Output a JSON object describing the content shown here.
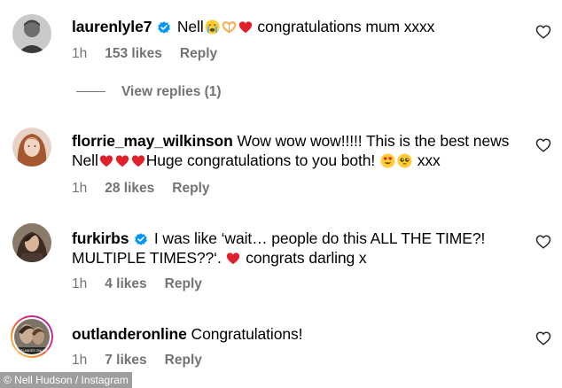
{
  "comments": [
    {
      "username": "laurenlyle7",
      "verified": true,
      "text_before": "Nell",
      "emojis": [
        "sobbing-face",
        "heart-hands",
        "red-heart"
      ],
      "text_after": "congratulations mum xxxx",
      "time": "1h",
      "likes": "153 likes",
      "reply": "Reply",
      "view_replies": "View replies (1)"
    },
    {
      "username": "florrie_may_wilkinson",
      "verified": false,
      "text_part1": "Wow wow wow!!!!! This is the best news Nell",
      "emojis1": [
        "red-heart",
        "red-heart",
        "red-heart"
      ],
      "text_part2": "Huge congratulations to you both!",
      "emojis2": [
        "heart-eyes-face",
        "pleading-face"
      ],
      "text_part3": "xxx",
      "time": "1h",
      "likes": "28 likes",
      "reply": "Reply"
    },
    {
      "username": "furkirbs",
      "verified": true,
      "text_part1": "I was like ‘wait… people do this ALL THE TIME?! MULTIPLE TIMES??‘.",
      "emojis1": [
        "red-heart"
      ],
      "text_part2": "congrats darling x",
      "time": "1h",
      "likes": "4 likes",
      "reply": "Reply"
    },
    {
      "username": "outlanderonline",
      "verified": false,
      "text": "Congratulations!",
      "avatar_caption": "OUTLANDER ONLINE",
      "time": "1h",
      "likes": "7 likes",
      "reply": "Reply"
    }
  ],
  "credit": "© Nell Hudson / Instagram",
  "colors": {
    "meta_gray": "#737373",
    "verified_blue": "#0095f6",
    "heart_red": "#e0202b",
    "story_ring": "#d62976"
  }
}
